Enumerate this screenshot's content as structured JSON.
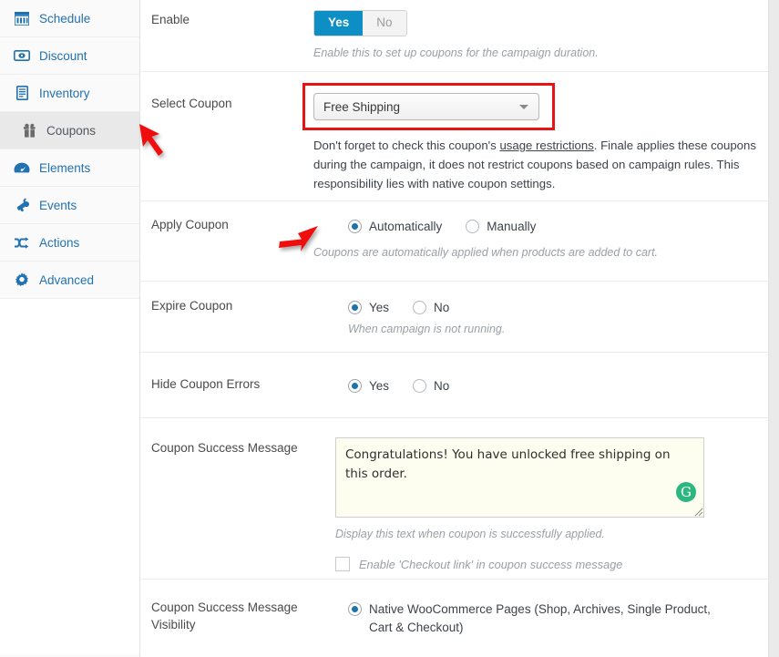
{
  "sidebar": {
    "items": [
      {
        "label": "Schedule",
        "icon": "calendar-icon",
        "active": false
      },
      {
        "label": "Discount",
        "icon": "money-bill-icon",
        "active": false
      },
      {
        "label": "Inventory",
        "icon": "clipboard-icon",
        "active": false
      },
      {
        "label": "Coupons",
        "icon": "gift-icon",
        "active": true
      },
      {
        "label": "Elements",
        "icon": "gauge-icon",
        "active": false
      },
      {
        "label": "Events",
        "icon": "megaphone-icon",
        "active": false
      },
      {
        "label": "Actions",
        "icon": "shuffle-icon",
        "active": false
      },
      {
        "label": "Advanced",
        "icon": "gear-icon",
        "active": false
      }
    ]
  },
  "form": {
    "enable": {
      "label": "Enable",
      "yes": "Yes",
      "no": "No",
      "selected": "Yes",
      "hint": "Enable this to set up coupons for the campaign duration."
    },
    "select_coupon": {
      "label": "Select Coupon",
      "value": "Free Shipping",
      "desc_before": "Don't forget to check this coupon's ",
      "desc_link": "usage restrictions",
      "desc_after": ". Finale applies these coupons during the campaign, it does not restrict coupons based on campaign rules. This responsibility lies with native coupon settings."
    },
    "apply_coupon": {
      "label": "Apply Coupon",
      "option_automatically": "Automatically",
      "option_manually": "Manually",
      "selected": "Automatically",
      "hint": "Coupons are automatically applied when products are added to cart."
    },
    "expire_coupon": {
      "label": "Expire Coupon",
      "yes": "Yes",
      "no": "No",
      "selected": "Yes",
      "hint": "When campaign is not running."
    },
    "hide_coupon_errors": {
      "label": "Hide Coupon Errors",
      "yes": "Yes",
      "no": "No",
      "selected": "Yes"
    },
    "success_message": {
      "label": "Coupon Success Message",
      "value": "Congratulations! You have unlocked free shipping on this order.",
      "hint": "Display this text when coupon is successfully applied.",
      "checkbox_label": "Enable 'Checkout link' in coupon success message",
      "checkbox_checked": false,
      "assistant_icon": "grammarly-icon"
    },
    "success_visibility": {
      "label": "Coupon Success Message Visibility",
      "option_native": "Native WooCommerce Pages (Shop, Archives, Single Product, Cart & Checkout)",
      "selected": "Native WooCommerce Pages (Shop, Archives, Single Product, Cart & Checkout)"
    }
  },
  "annotations": {
    "arrow_select_coupon": "red-arrow-icon",
    "arrow_apply_coupon": "red-arrow-icon",
    "highlight_color": "#e81414"
  },
  "colors": {
    "accent": "#0d8ec4",
    "link": "#2271b1",
    "radio_dot": "#1e73a8",
    "textarea_bg": "#fdfdf0",
    "grammarly_green": "#2cb680"
  }
}
